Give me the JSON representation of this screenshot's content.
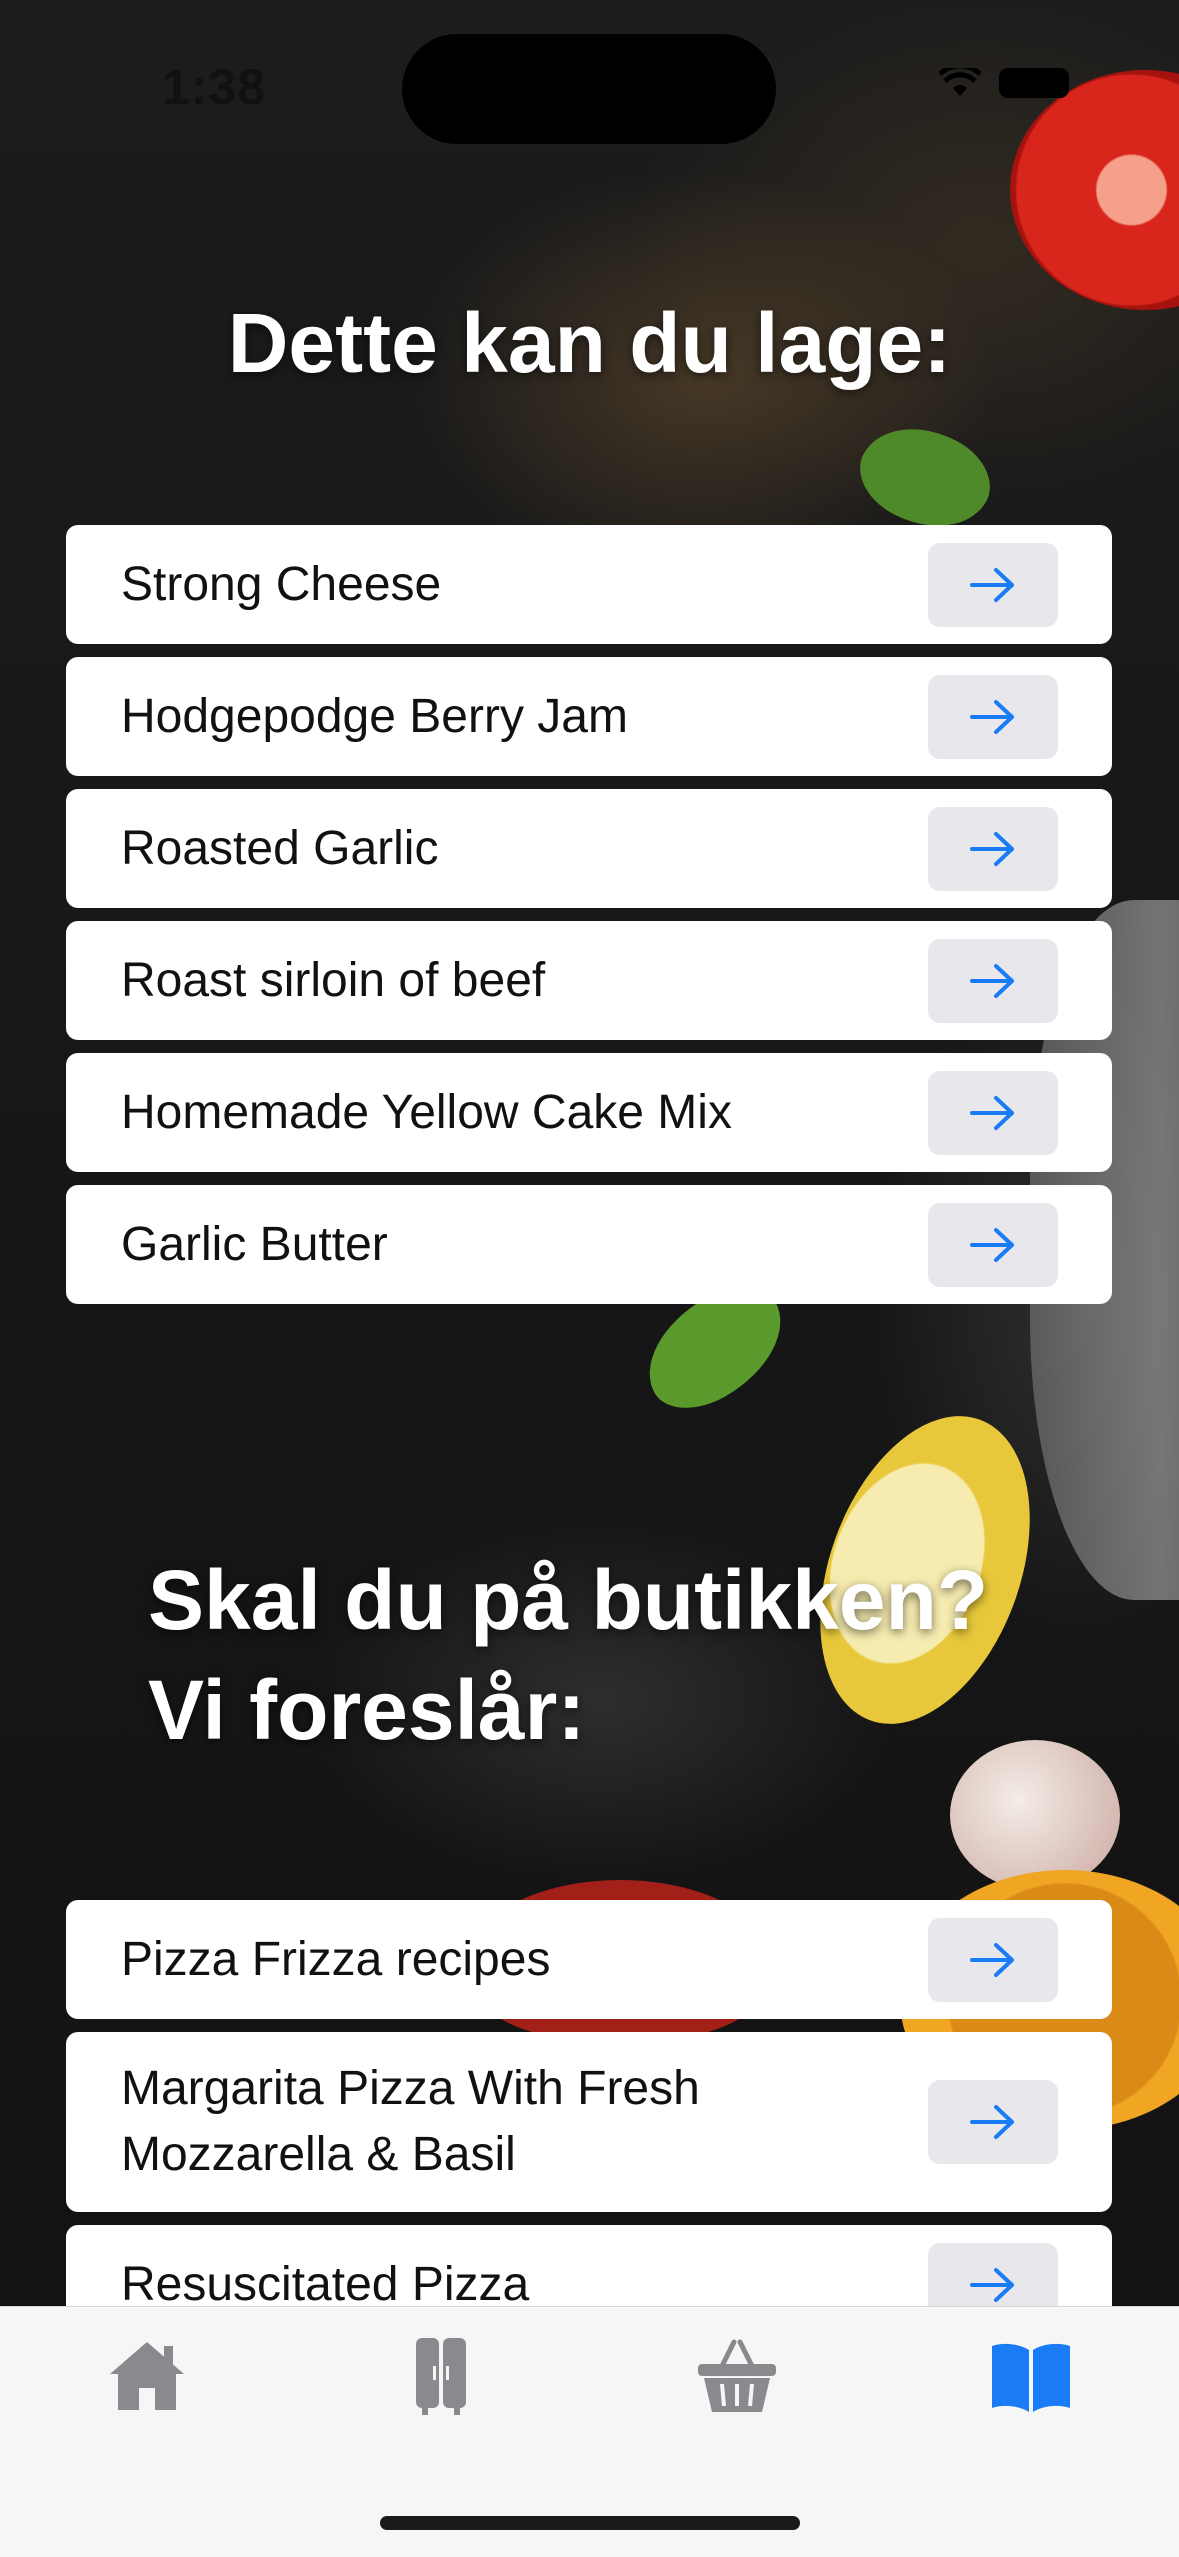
{
  "status_bar": {
    "time": "1:38"
  },
  "sections": {
    "can_make": {
      "heading": "Dette kan du lage:",
      "recipes": [
        {
          "title": "Strong Cheese"
        },
        {
          "title": "Hodgepodge Berry Jam"
        },
        {
          "title": "Roasted Garlic"
        },
        {
          "title": "Roast sirloin of beef"
        },
        {
          "title": "Homemade Yellow Cake Mix"
        },
        {
          "title": "Garlic Butter"
        }
      ]
    },
    "store_suggestions": {
      "heading": "Skal du på butikken?\nVi foreslår:",
      "recipes": [
        {
          "title": "Pizza Frizza recipes"
        },
        {
          "title": "Margarita Pizza With Fresh Mozzarella & Basil"
        },
        {
          "title": "Resuscitated Pizza"
        }
      ]
    }
  },
  "tab_bar": {
    "tabs": [
      {
        "icon": "home-icon",
        "active": false
      },
      {
        "icon": "fridge-icon",
        "active": false
      },
      {
        "icon": "basket-icon",
        "active": false
      },
      {
        "icon": "book-icon",
        "active": true
      }
    ],
    "active_color": "#1a7cf5",
    "inactive_color": "#8a8a8e"
  },
  "colors": {
    "accent": "#1a7cf5"
  }
}
